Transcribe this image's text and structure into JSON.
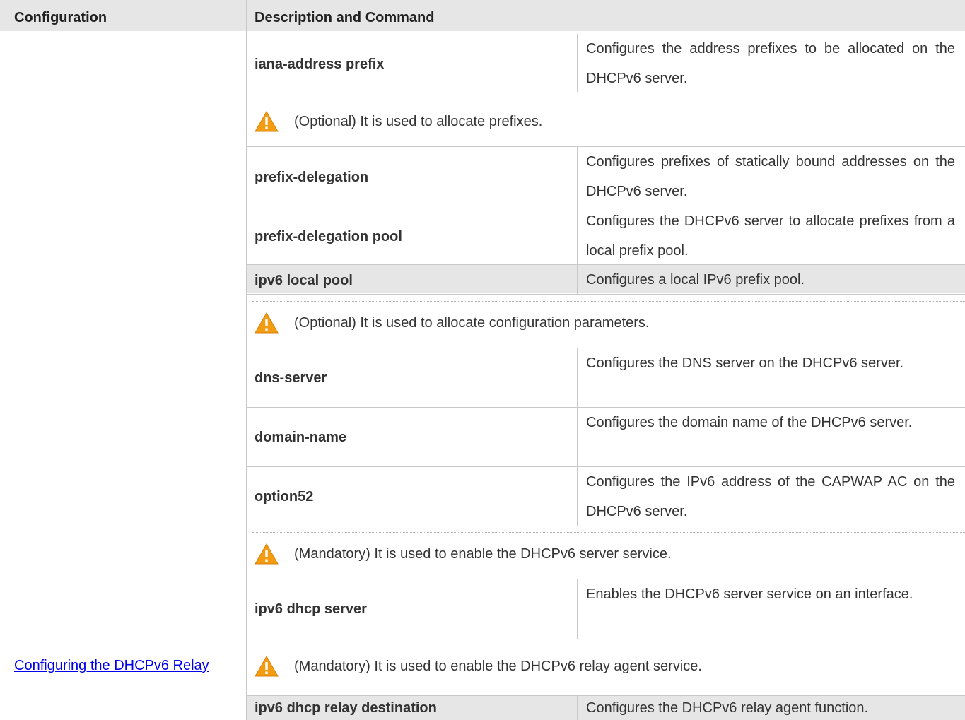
{
  "header": {
    "col1": "Configuration",
    "col2": "Description and Command"
  },
  "rows": [
    {
      "command": "iana-address prefix",
      "description": "Configures the address prefixes to be allocated on the DHCPv6 server."
    },
    {
      "note": "(Optional) It is used to allocate prefixes."
    },
    {
      "command": "prefix-delegation",
      "description": "Configures prefixes of statically bound addresses on the DHCPv6 server."
    },
    {
      "command": "prefix-delegation pool",
      "description": "Configures the DHCPv6 server to allocate prefixes from a local prefix pool."
    },
    {
      "command": "ipv6 local pool",
      "description": "Configures a local IPv6 prefix pool."
    },
    {
      "note": "(Optional) It is used to allocate configuration parameters."
    },
    {
      "command": "dns-server",
      "description": "Configures the DNS server on the DHCPv6 server."
    },
    {
      "command": "domain-name",
      "description": "Configures the domain name of the DHCPv6 server."
    },
    {
      "command": "option52",
      "description": "Configures the IPv6 address of the CAPWAP AC on the DHCPv6 server."
    },
    {
      "note": "(Mandatory) It is used to enable the DHCPv6 server service."
    },
    {
      "command": "ipv6 dhcp server",
      "description": "Enables the DHCPv6 server service on an interface."
    }
  ],
  "relay": {
    "link": "Configuring the DHCPv6 Relay",
    "note": "(Mandatory) It is used to enable the DHCPv6 relay agent service.",
    "command": "ipv6 dhcp relay destination",
    "description": "Configures the DHCPv6 relay agent function."
  },
  "icon": "warning-icon",
  "colors": {
    "header_bg": "#e6e6e6",
    "warning": "#f39c12",
    "link": "#0000ee"
  }
}
